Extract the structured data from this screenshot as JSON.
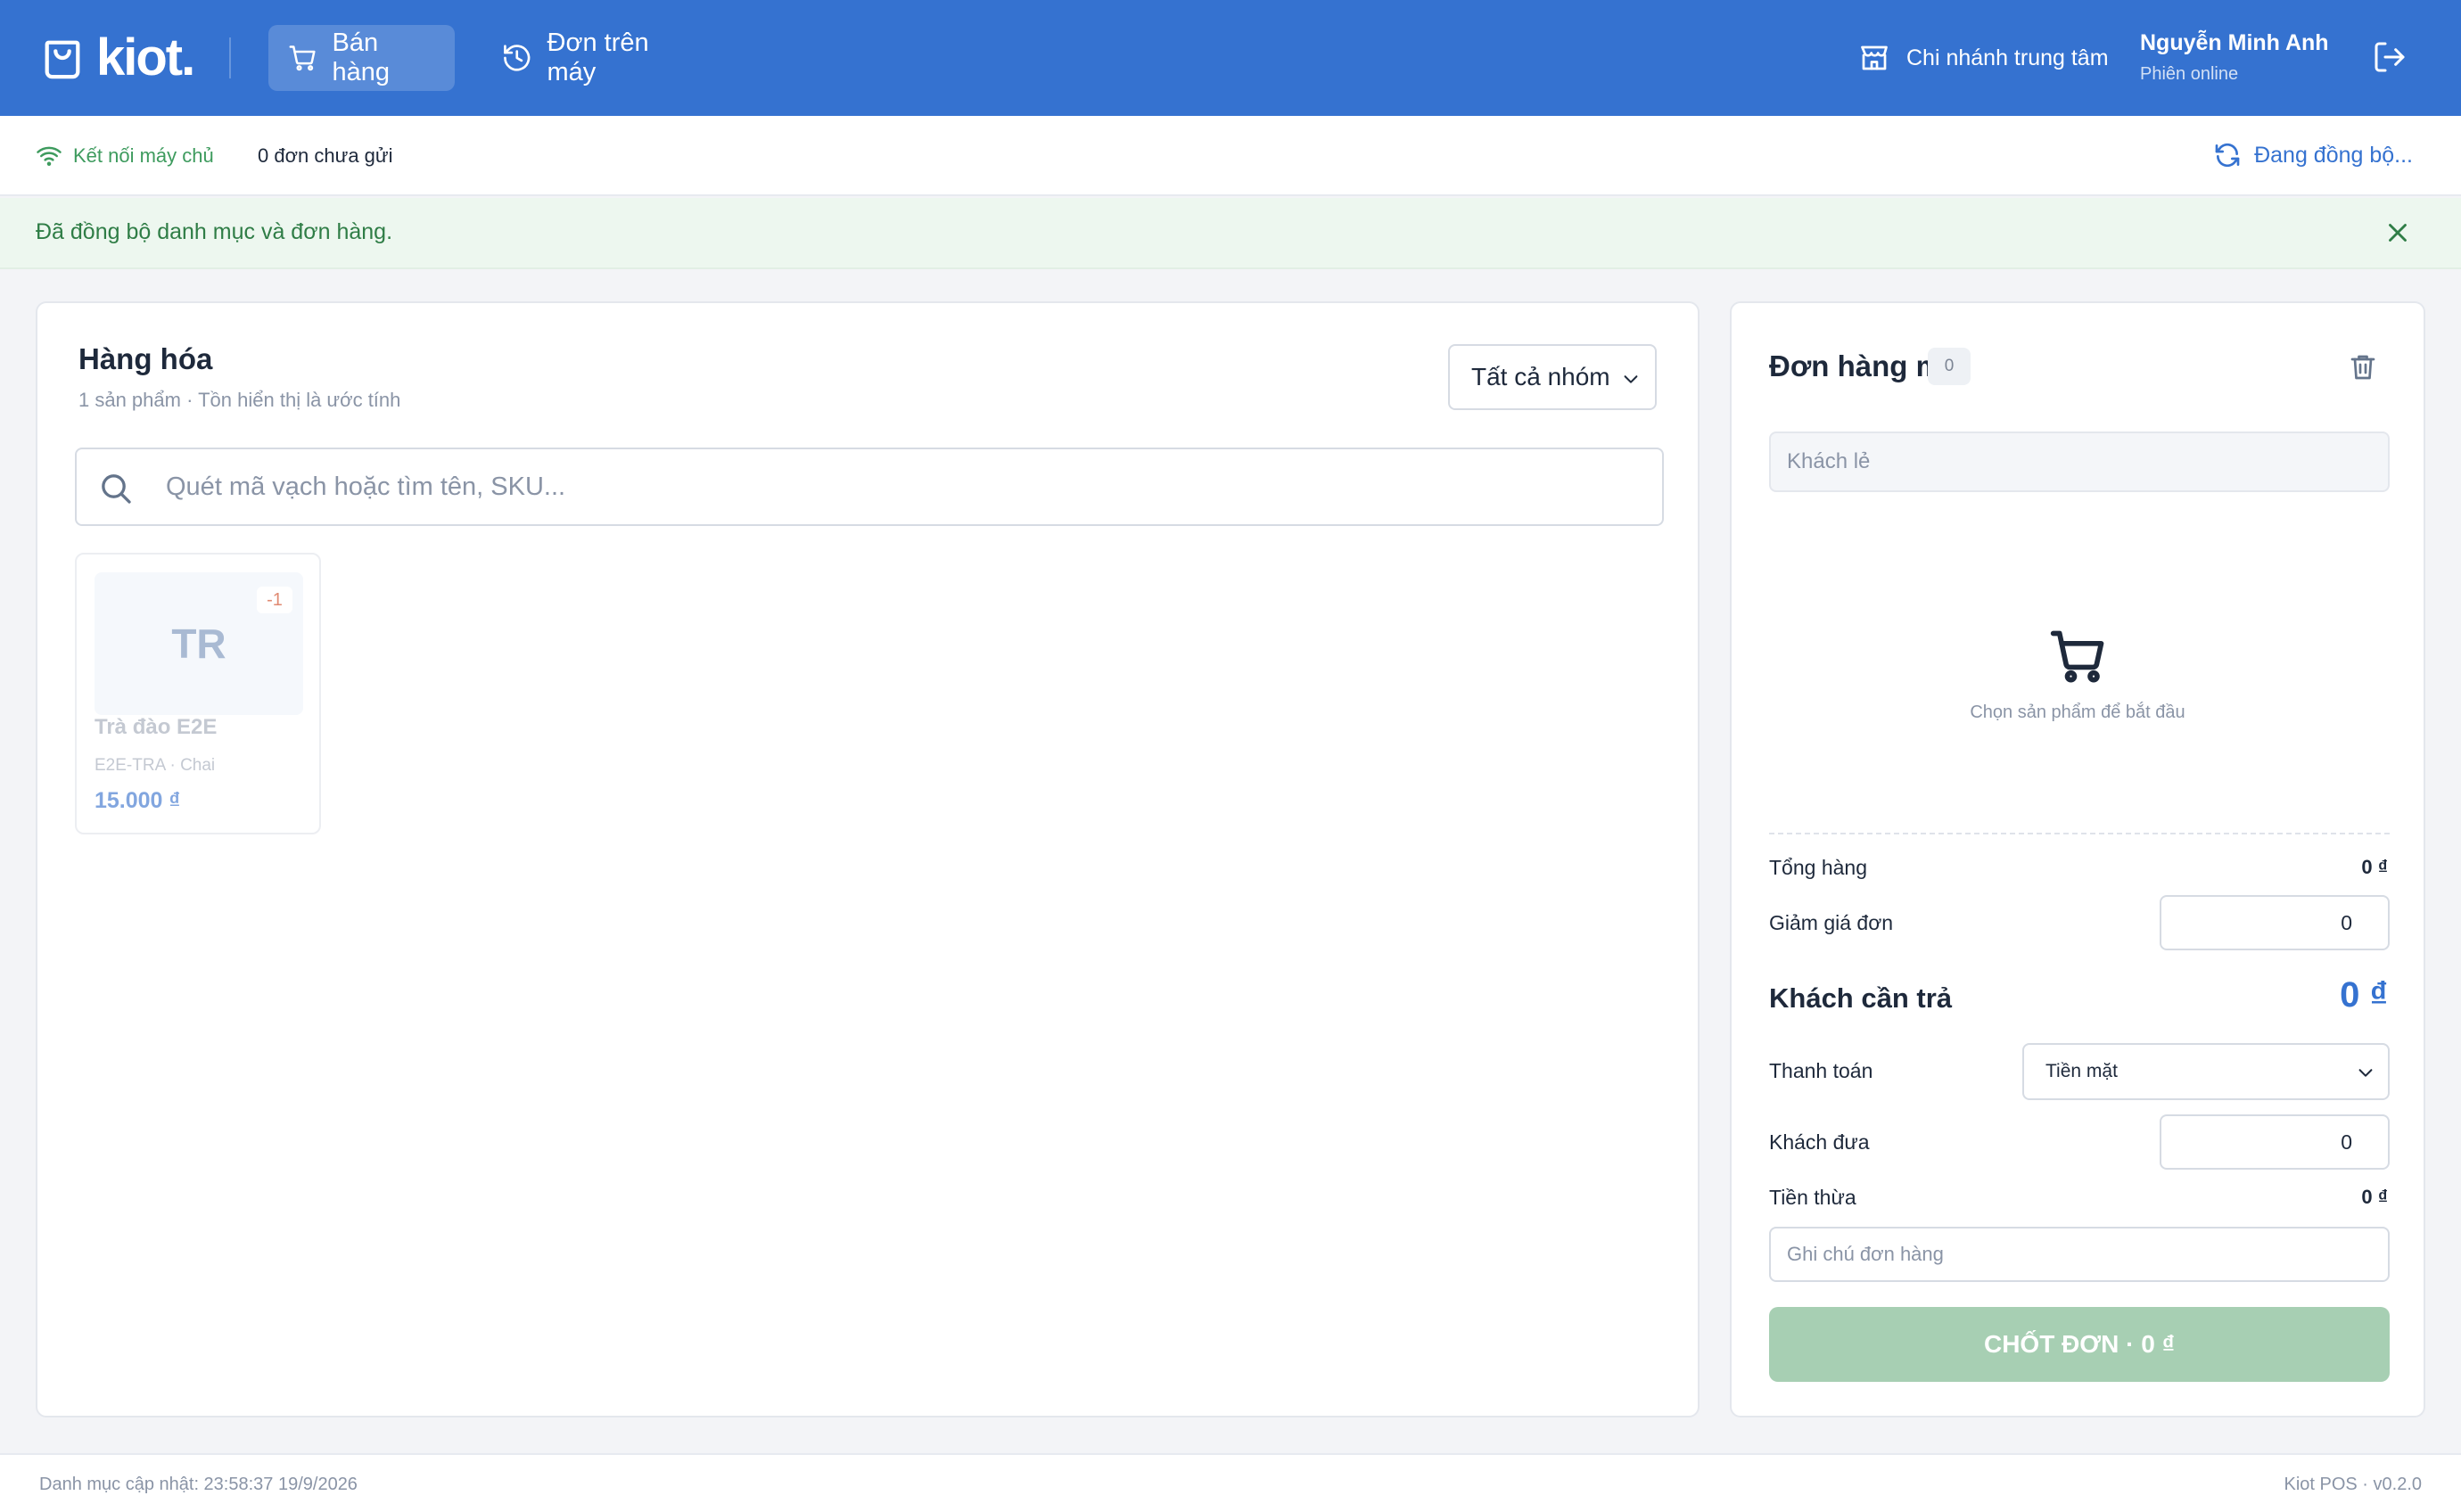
{
  "colors": {
    "brand": "#3572d0",
    "success": "#3e9b5e",
    "banner_bg": "#edf7ef",
    "checkout_disabled": "#a7cfb3",
    "stock_negative": "#e08a72"
  },
  "header": {
    "logo_text": "kiot.",
    "logo_icon": "shopping-bag-icon",
    "tabs": [
      {
        "label": "Bán hàng",
        "icon": "cart-icon",
        "active": true
      },
      {
        "label": "Đơn trên máy",
        "icon": "history-icon",
        "active": false
      }
    ],
    "branch": {
      "label": "Chi nhánh trung tâm",
      "icon": "store-icon"
    },
    "user": {
      "name": "Nguyễn Minh Anh",
      "status": "Phiên online"
    },
    "logout_icon": "logout-icon"
  },
  "statusbar": {
    "connection": "Kết nối máy chủ",
    "pending_orders": "0 đơn chưa gửi",
    "sync": "Đang đồng bộ..."
  },
  "banner": {
    "message": "Đã đồng bộ danh mục và đơn hàng."
  },
  "goods": {
    "title": "Hàng hóa",
    "subtitle": "1 sản phẩm · Tồn hiển thị là ước tính",
    "group_filter": "Tất cả nhóm",
    "search_placeholder": "Quét mã vạch hoặc tìm tên, SKU...",
    "products": [
      {
        "initials": "TR",
        "stock": "-1",
        "name": "Trà đào E2E",
        "meta": "E2E-TRA · Chai",
        "price": "15.000 ₫"
      }
    ]
  },
  "order": {
    "title": "Đơn hàng mới",
    "item_count": "0",
    "customer_placeholder": "Khách lẻ",
    "empty_text": "Chọn sản phẩm để bắt đầu",
    "subtotal_label": "Tổng hàng",
    "subtotal_value": "0 ₫",
    "discount_label": "Giảm giá đơn",
    "discount_value": "0",
    "due_label": "Khách cần trả",
    "due_value": "0 ₫",
    "payment_label": "Thanh toán",
    "payment_method": "Tiền mặt",
    "paid_label": "Khách đưa",
    "paid_value": "0",
    "change_label": "Tiền thừa",
    "change_value": "0 ₫",
    "note_placeholder": "Ghi chú đơn hàng",
    "checkout_label": "CHỐT ĐƠN · 0 ₫"
  },
  "footer": {
    "catalog_updated": "Danh mục cập nhật: 23:58:37 19/9/2026",
    "version": "Kiot POS · v0.2.0"
  }
}
